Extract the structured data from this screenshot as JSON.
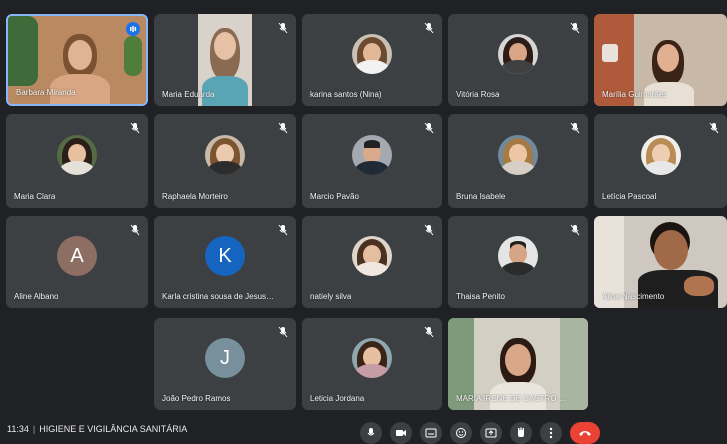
{
  "participants": [
    {
      "name": "Barbara Miranda",
      "speaking": true
    },
    {
      "name": "Maria Eduarda"
    },
    {
      "name": "karina santos (Nina)"
    },
    {
      "name": "Vitória Rosa"
    },
    {
      "name": "Marília Guimarães"
    },
    {
      "name": "Maria Clara"
    },
    {
      "name": "Raphaela Morteiro"
    },
    {
      "name": "Marcio Pavão"
    },
    {
      "name": "Bruna Isabele"
    },
    {
      "name": "Letícia Pascoal"
    },
    {
      "name": "Aline Albano",
      "initial": "A",
      "color": "#8d6e63"
    },
    {
      "name": "Karla cristina sousa de Jesus Cru...",
      "initial": "K",
      "color": "#1565c0"
    },
    {
      "name": "natiely silva"
    },
    {
      "name": "Thaisa Penito"
    },
    {
      "name": "Aline Nascimento"
    },
    {
      "name": "João Pedro Ramos",
      "initial": "J",
      "color": "#78909c"
    },
    {
      "name": "Leticia Jordana"
    },
    {
      "name": "MARIA IRENE DE CASTRO BAR..."
    }
  ],
  "meeting": {
    "time": "11:34",
    "separator": "|",
    "title": "HIGIENE E VIGILÂNCIA SANITÁRIA"
  },
  "controls": [
    "mic-icon",
    "camera-icon",
    "captions-icon",
    "emoji-icon",
    "present-icon",
    "hand-icon",
    "more-icon",
    "end-call-icon"
  ]
}
